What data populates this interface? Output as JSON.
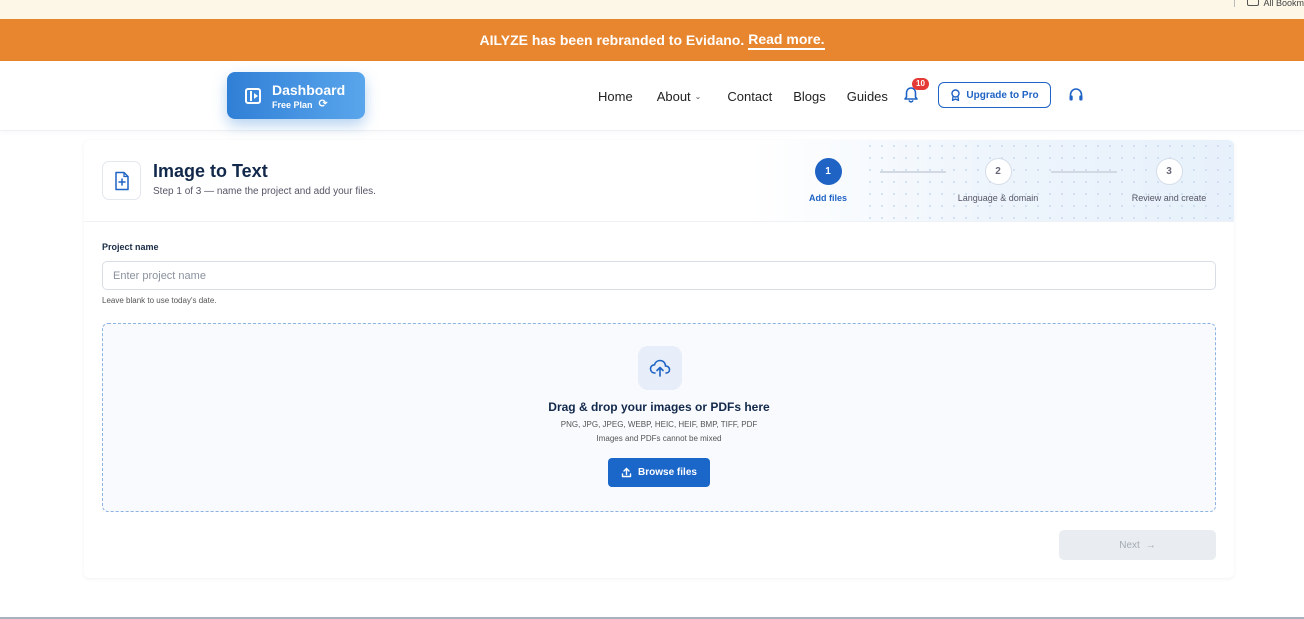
{
  "bookmarks": {
    "label": "All Bookm"
  },
  "banner": {
    "text": "AILYZE has been rebranded to Evidano.",
    "link": "Read more.",
    "color": "#e8862f"
  },
  "navbar": {
    "dashboard": {
      "title": "Dashboard",
      "plan": "Free Plan",
      "icon": "panel-toggle-icon",
      "refresh_icon": "refresh-icon"
    },
    "links": {
      "home": "Home",
      "about": "About",
      "contact": "Contact",
      "blogs": "Blogs",
      "guides": "Guides"
    },
    "notifications": {
      "count": "10",
      "icon": "bell-icon"
    },
    "upgrade": {
      "label": "Upgrade to Pro",
      "icon": "badge-icon"
    },
    "support": {
      "icon": "headset-icon"
    }
  },
  "card": {
    "title": "Image to Text",
    "subtitle": "Step 1 of 3 — name the project and add your files.",
    "icon": "file-add-icon",
    "steps": [
      {
        "num": "1",
        "label": "Add files",
        "state": "active"
      },
      {
        "num": "2",
        "label": "Language & domain",
        "state": "todo"
      },
      {
        "num": "3",
        "label": "Review and create",
        "state": "todo"
      }
    ]
  },
  "project": {
    "label": "Project name",
    "value": "",
    "placeholder": "Enter project name",
    "hint": "Leave blank to use today's date."
  },
  "dropzone": {
    "icon": "cloud-upload-icon",
    "title": "Drag & drop your images or PDFs here",
    "types": "PNG, JPG, JPEG, WEBP, HEIC, HEIF, BMP, TIFF, PDF",
    "note": "Images and PDFs cannot be mixed",
    "button": "Browse files",
    "button_icon": "upload-icon"
  },
  "next": {
    "label": "Next",
    "icon": "arrow-right-icon",
    "disabled": true
  },
  "colors": {
    "primary": "#1f63c4",
    "accent": "#e8862f",
    "badge": "#e53935"
  }
}
